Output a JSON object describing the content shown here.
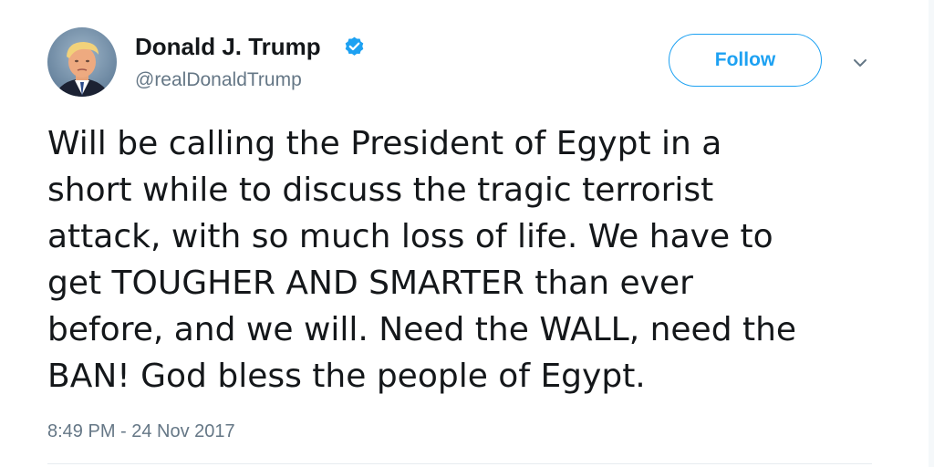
{
  "author": {
    "display_name": "Donald J. Trump",
    "handle": "@realDonaldTrump",
    "verified": true,
    "avatar_icon": "profile-photo"
  },
  "follow_button": {
    "label": "Follow"
  },
  "menu": {
    "icon": "chevron-down-icon"
  },
  "tweet": {
    "lines": [
      "Will be calling the President of Egypt in a",
      "short while to discuss the tragic terrorist",
      "attack, with so much loss of life. We have to",
      "get TOUGHER AND SMARTER than ever",
      "before, and we will. Need the WALL, need the",
      "BAN! God bless the people of Egypt."
    ],
    "timestamp": "8:49 PM - 24 Nov 2017"
  },
  "colors": {
    "accent": "#1da1f2",
    "text_primary": "#14171a",
    "text_secondary": "#657786"
  }
}
